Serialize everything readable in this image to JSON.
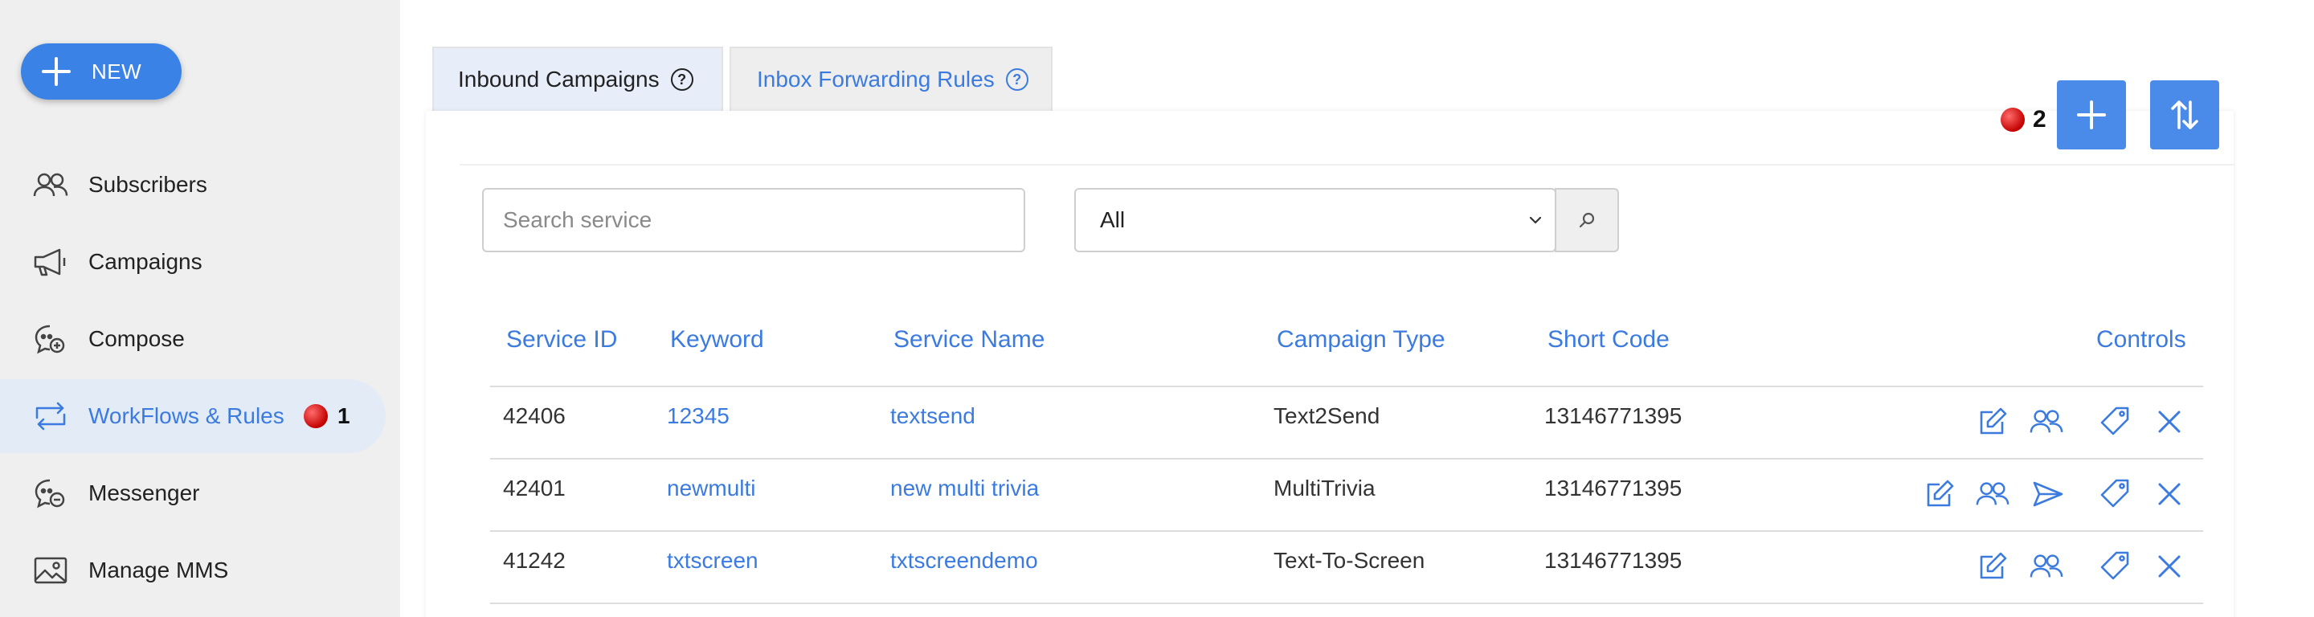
{
  "sidebar": {
    "new_label": "NEW",
    "items": [
      {
        "label": "Subscribers",
        "icon": "users-icon"
      },
      {
        "label": "Campaigns",
        "icon": "megaphone-icon"
      },
      {
        "label": "Compose",
        "icon": "compose-icon"
      },
      {
        "label": "WorkFlows & Rules",
        "icon": "workflow-icon",
        "badge": "1",
        "active": true
      },
      {
        "label": "Messenger",
        "icon": "messenger-icon"
      },
      {
        "label": "Manage MMS",
        "icon": "image-icon"
      }
    ]
  },
  "tabs": [
    {
      "label": "Inbound Campaigns",
      "active": true
    },
    {
      "label": "Inbox Forwarding Rules",
      "active": false
    }
  ],
  "toolbar": {
    "alert_count": "2"
  },
  "filters": {
    "search_placeholder": "Search service",
    "search_value": "",
    "select_value": "All"
  },
  "table": {
    "columns": [
      "Service ID",
      "Keyword",
      "Service Name",
      "Campaign Type",
      "Short Code",
      "Controls"
    ],
    "rows": [
      {
        "service_id": "42406",
        "keyword": "12345",
        "service_name": "textsend",
        "campaign_type": "Text2Send",
        "short_code": "13146771395"
      },
      {
        "service_id": "42401",
        "keyword": "newmulti",
        "service_name": "new multi trivia",
        "campaign_type": "MultiTrivia",
        "short_code": "13146771395"
      },
      {
        "service_id": "41242",
        "keyword": "txtscreen",
        "service_name": "txtscreendemo",
        "campaign_type": "Text-To-Screen",
        "short_code": "13146771395"
      }
    ]
  },
  "colors": {
    "accent": "#3b7be0",
    "button": "#4a8ae8",
    "sidebar_bg": "#efefef",
    "active_bg": "#e3ebf7"
  }
}
